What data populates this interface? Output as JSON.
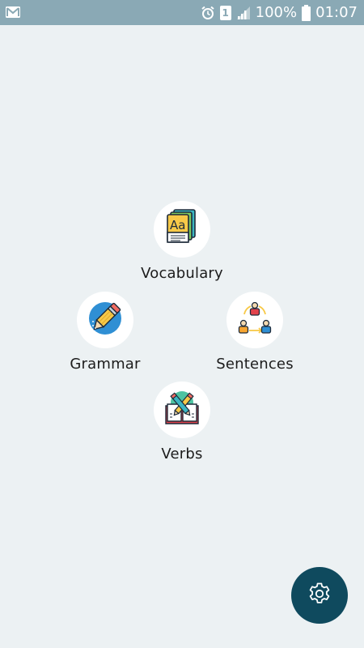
{
  "status_bar": {
    "notification_icon": "mail-icon",
    "alarm_icon": "alarm-icon",
    "sim_label": "1",
    "signal_icon": "signal-icon",
    "battery_percent": "100%",
    "battery_icon": "battery-icon",
    "time": "01:07"
  },
  "menu": {
    "vocabulary": {
      "label": "Vocabulary",
      "icon": "book-aa-icon"
    },
    "grammar": {
      "label": "Grammar",
      "icon": "pencil-icon"
    },
    "sentences": {
      "label": "Sentences",
      "icon": "people-conversation-icon"
    },
    "verbs": {
      "label": "Verbs",
      "icon": "open-book-pencils-icon"
    }
  },
  "fab": {
    "icon": "gear-icon"
  },
  "colors": {
    "status_bar": "#8aa9b5",
    "background": "#ecf1f3",
    "fab": "#0f4a5e"
  }
}
